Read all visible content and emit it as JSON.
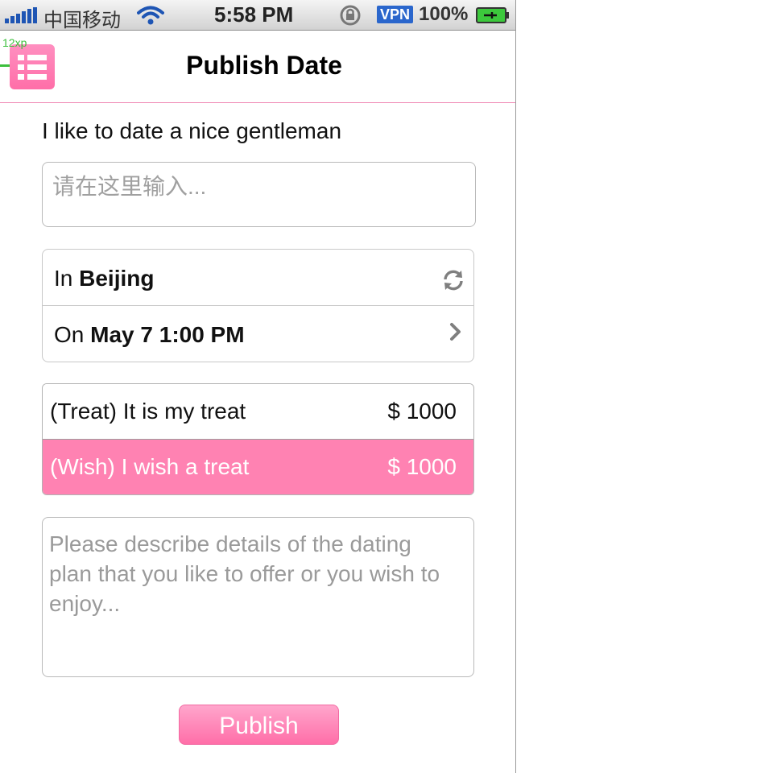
{
  "status_bar": {
    "carrier": "中国移动",
    "time": "5:58 PM",
    "vpn": "VPN",
    "battery": "100%"
  },
  "nav": {
    "title": "Publish Date",
    "debug_label": "12xp",
    "menu_icon": "list-icon"
  },
  "form": {
    "intro": "I like to date a nice gentleman",
    "intro_placeholder": "请在这里输入...",
    "location_prefix": "In",
    "location": "Beijing",
    "time_prefix": "On",
    "time": "May 7 1:00 PM",
    "options": [
      {
        "label": "(Treat) It is my treat",
        "amount": "$ 1000",
        "selected": false
      },
      {
        "label": "(Wish) I wish a treat",
        "amount": "$ 1000",
        "selected": true
      }
    ],
    "details_placeholder": "Please describe details of the dating plan that you like to offer or you wish to enjoy...",
    "publish_label": "Publish"
  },
  "colors": {
    "accent_pink": "#ff82b2",
    "status_blue": "#1e55b4"
  }
}
